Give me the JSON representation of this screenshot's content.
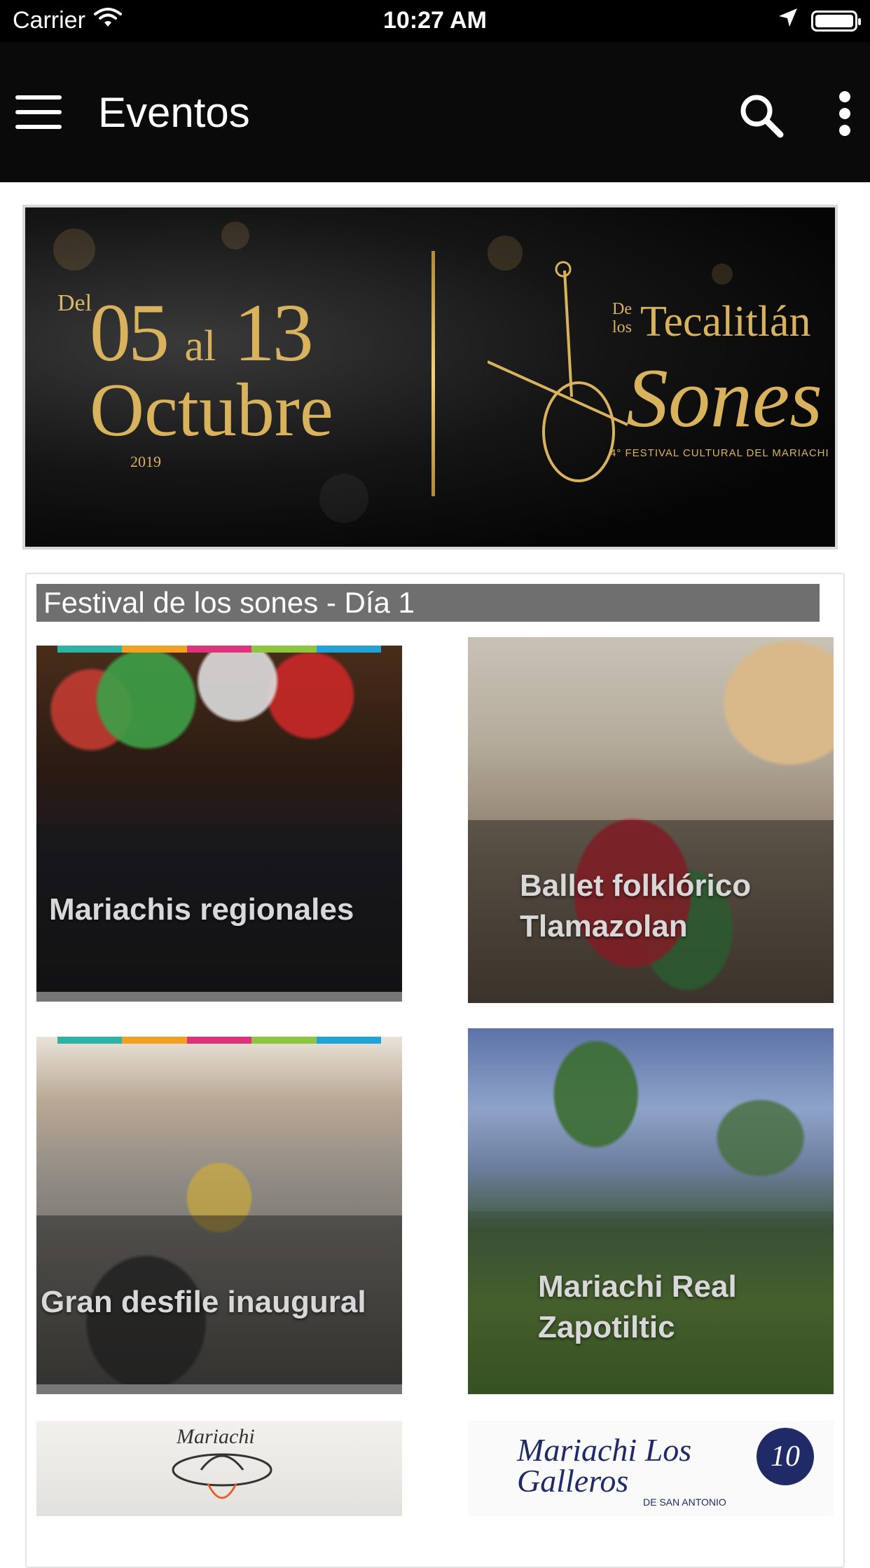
{
  "status_bar": {
    "carrier": "Carrier",
    "time": "10:27 AM",
    "battery_level": 1.0,
    "icons": [
      "wifi-icon",
      "location-arrow-icon",
      "battery-icon"
    ]
  },
  "app_bar": {
    "title": "Eventos",
    "icons": [
      "menu-icon",
      "search-icon",
      "more-vertical-icon"
    ]
  },
  "banner": {
    "prefix": "Del",
    "date_start": "05",
    "date_connector": "al",
    "date_end": "13",
    "month": "Octubre",
    "year": "2019",
    "logo_small": "De los",
    "logo_top": "Tecalitlán",
    "logo_main": "Sones",
    "logo_subtitle": "4° FESTIVAL CULTURAL DEL MARIACHI",
    "accent_color": "#d8b25c"
  },
  "section": {
    "title": "Festival de los sones - Día 1"
  },
  "events": [
    {
      "label": "Mariachis regionales"
    },
    {
      "label": "Ballet folklórico Tlamazolan"
    },
    {
      "label": "Gran desfile inaugural"
    },
    {
      "label": "Mariachi Real Zapotiltic"
    },
    {
      "label": "Mariachi"
    },
    {
      "label": "Mariachi Los Galleros",
      "subtitle": "DE SAN ANTONIO",
      "badge": "10"
    }
  ]
}
